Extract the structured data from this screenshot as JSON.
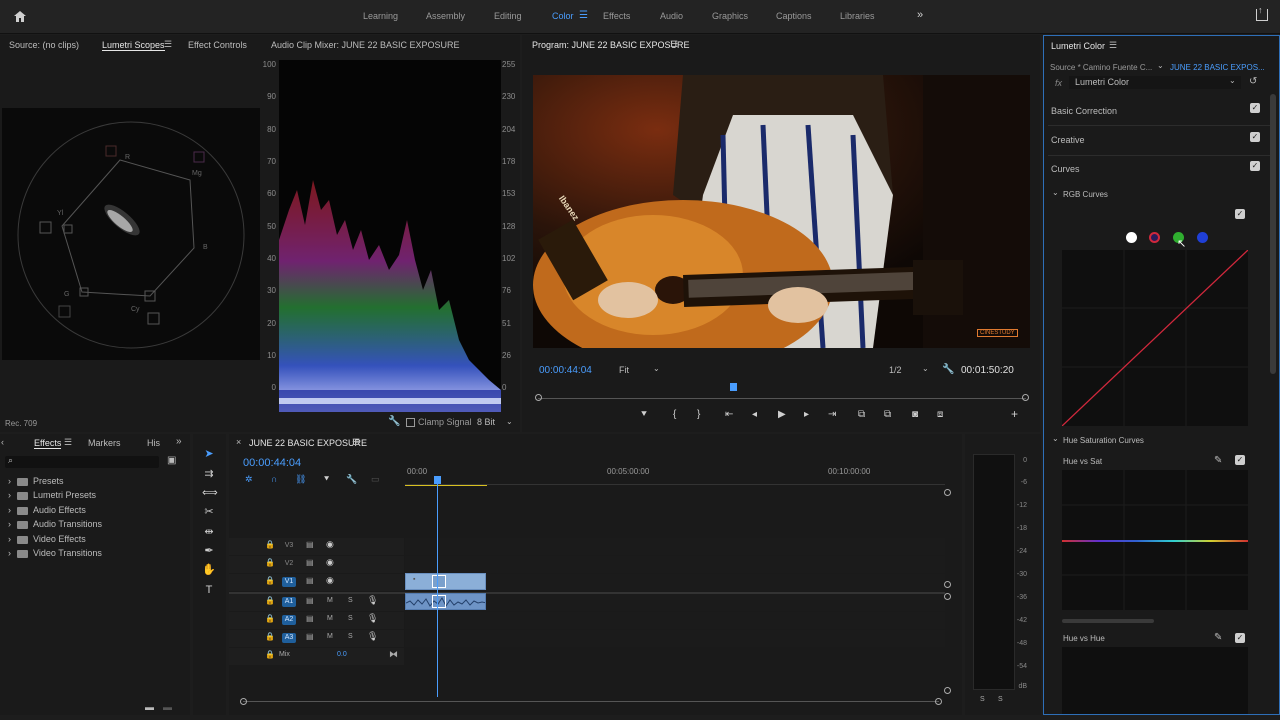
{
  "workspaces": {
    "tabs": [
      "Learning",
      "Assembly",
      "Editing",
      "Color",
      "Effects",
      "Audio",
      "Graphics",
      "Captions",
      "Libraries"
    ],
    "active": "Color"
  },
  "source_panel": {
    "tabs": [
      "Source: (no clips)",
      "Lumetri Scopes",
      "Effect Controls",
      "Audio Clip Mixer: JUNE 22 BASIC EXPOSURE"
    ],
    "active": "Lumetri Scopes",
    "vectorscope_labels": [
      "R",
      "Mg",
      "B",
      "Cy",
      "G",
      "Yl"
    ],
    "parade_left_ticks": [
      "100",
      "90",
      "80",
      "70",
      "60",
      "50",
      "40",
      "30",
      "20",
      "10",
      "0"
    ],
    "parade_right_ticks": [
      "255",
      "230",
      "204",
      "178",
      "153",
      "128",
      "102",
      "76",
      "51",
      "26",
      "0"
    ],
    "clamp_label": "Clamp Signal",
    "bit_depth": "8 Bit",
    "colorspace": "Rec. 709"
  },
  "program": {
    "title": "Program: JUNE 22 BASIC EXPOSURE",
    "timecode": "00:00:44:04",
    "fit": "Fit",
    "resolution": "1/2",
    "duration": "00:01:50:20",
    "watermark": "CINESTUDY",
    "guitar_brand": "Ibanez",
    "playhead_fraction": 0.4
  },
  "lumetri": {
    "title": "Lumetri Color",
    "source": "Source * Camino Fuente C...",
    "target": "JUNE 22 BASIC EXPOS...",
    "effect": "Lumetri Color",
    "sections": [
      "Basic Correction",
      "Creative",
      "Curves"
    ],
    "rgb_curves": "RGB Curves",
    "hue_sat_curves": "Hue Saturation Curves",
    "hue_vs_sat": "Hue vs Sat",
    "hue_vs_hue": "Hue vs Hue",
    "channel_colors": [
      "#ffffff",
      "#d0283c",
      "#2fae2f",
      "#1f3fd6"
    ]
  },
  "effects_panel": {
    "tabs": [
      "Effects",
      "Markers",
      "His"
    ],
    "active": "Effects",
    "items": [
      "Presets",
      "Lumetri Presets",
      "Audio Effects",
      "Audio Transitions",
      "Video Effects",
      "Video Transitions"
    ]
  },
  "timeline": {
    "title": "JUNE 22 BASIC EXPOSURE",
    "timecode": "00:00:44:04",
    "ruler": [
      "00:00",
      "00:05:00:00",
      "00:10:00:00"
    ],
    "video_tracks": [
      "V3",
      "V2",
      "V1"
    ],
    "audio_tracks": [
      "A1",
      "A2",
      "A3"
    ],
    "mute": "M",
    "solo": "S",
    "mix_label": "Mix",
    "mix_value": "0.0"
  },
  "meter": {
    "ticks": [
      "0",
      "-6",
      "-12",
      "-18",
      "-24",
      "-30",
      "-36",
      "-42",
      "-48",
      "-54",
      "dB"
    ],
    "solo_labels": [
      "S",
      "S"
    ]
  }
}
